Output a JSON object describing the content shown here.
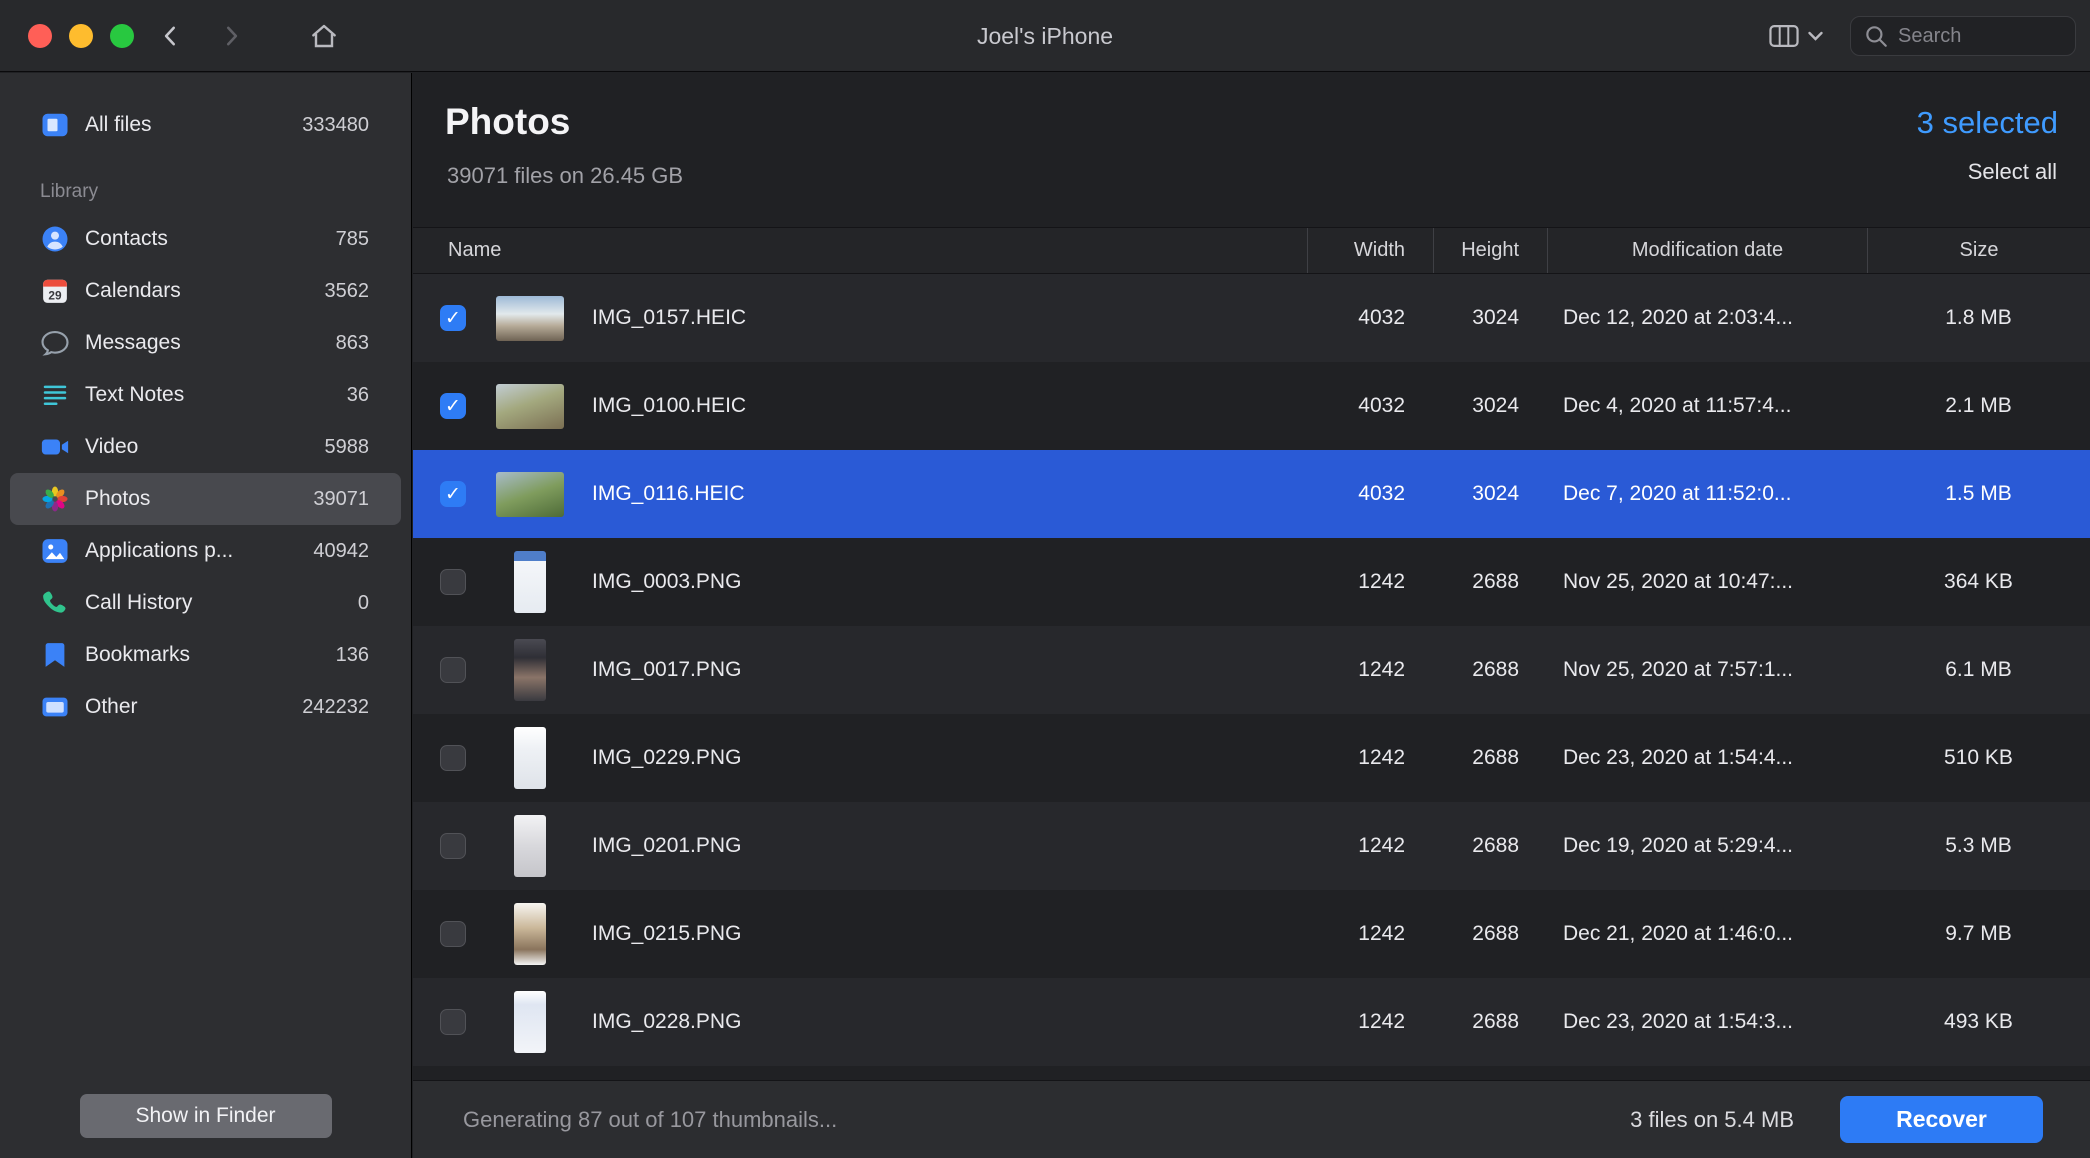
{
  "titlebar": {
    "title": "Joel's iPhone",
    "traffic_lights": [
      "close",
      "minimize",
      "zoom"
    ],
    "back_icon": "chevron-left-icon",
    "forward_icon": "chevron-right-icon",
    "home_icon": "home-icon",
    "view_selector_icon": "view-columns-icon",
    "view_selector_chevron": "chevron-down-icon",
    "search_icon": "search-icon",
    "search_placeholder": "Search"
  },
  "sidebar": {
    "all_files": {
      "label": "All files",
      "count": "333480",
      "icon": "all-files-icon"
    },
    "section_label": "Library",
    "items": [
      {
        "label": "Contacts",
        "count": "785",
        "icon": "contacts-icon",
        "selected": false
      },
      {
        "label": "Calendars",
        "count": "3562",
        "icon": "calendars-icon",
        "selected": false
      },
      {
        "label": "Messages",
        "count": "863",
        "icon": "messages-icon",
        "selected": false
      },
      {
        "label": "Text Notes",
        "count": "36",
        "icon": "text-notes-icon",
        "selected": false
      },
      {
        "label": "Video",
        "count": "5988",
        "icon": "video-icon",
        "selected": false
      },
      {
        "label": "Photos",
        "count": "39071",
        "icon": "photos-icon",
        "selected": true
      },
      {
        "label": "Applications p...",
        "count": "40942",
        "icon": "applications-icon",
        "selected": false
      },
      {
        "label": "Call History",
        "count": "0",
        "icon": "call-history-icon",
        "selected": false
      },
      {
        "label": "Bookmarks",
        "count": "136",
        "icon": "bookmarks-icon",
        "selected": false
      },
      {
        "label": "Other",
        "count": "242232",
        "icon": "other-icon",
        "selected": false
      }
    ],
    "show_in_finder_label": "Show in Finder"
  },
  "main": {
    "title": "Photos",
    "subtitle": "39071 files on 26.45 GB",
    "selection": {
      "count_label": "3 selected",
      "select_all_label": "Select all"
    },
    "table": {
      "columns": [
        "Name",
        "Width",
        "Height",
        "Modification date",
        "Size"
      ],
      "rows": [
        {
          "name": "IMG_0157.HEIC",
          "width": "4032",
          "height": "3024",
          "date": "Dec 12, 2020 at 2:03:4...",
          "size": "1.8 MB",
          "checked": true,
          "selected": false,
          "thumb": "mountain-snow",
          "orientation": "landscape"
        },
        {
          "name": "IMG_0100.HEIC",
          "width": "4032",
          "height": "3024",
          "date": "Dec 4, 2020 at 11:57:4...",
          "size": "2.1 MB",
          "checked": true,
          "selected": false,
          "thumb": "aerial-valley",
          "orientation": "landscape"
        },
        {
          "name": "IMG_0116.HEIC",
          "width": "4032",
          "height": "3024",
          "date": "Dec 7, 2020 at 11:52:0...",
          "size": "1.5 MB",
          "checked": true,
          "selected": true,
          "thumb": "aerial-green",
          "orientation": "landscape"
        },
        {
          "name": "IMG_0003.PNG",
          "width": "1242",
          "height": "2688",
          "date": "Nov 25, 2020 at 10:47:...",
          "size": "364 KB",
          "checked": false,
          "selected": false,
          "thumb": "screenshot-blue-header",
          "orientation": "portrait"
        },
        {
          "name": "IMG_0017.PNG",
          "width": "1242",
          "height": "2688",
          "date": "Nov 25, 2020 at 7:57:1...",
          "size": "6.1 MB",
          "checked": false,
          "selected": false,
          "thumb": "screenshot-dark",
          "orientation": "portrait"
        },
        {
          "name": "IMG_0229.PNG",
          "width": "1242",
          "height": "2688",
          "date": "Dec 23, 2020 at 1:54:4...",
          "size": "510 KB",
          "checked": false,
          "selected": false,
          "thumb": "screenshot-light",
          "orientation": "portrait"
        },
        {
          "name": "IMG_0201.PNG",
          "width": "1242",
          "height": "2688",
          "date": "Dec 19, 2020 at 5:29:4...",
          "size": "5.3 MB",
          "checked": false,
          "selected": false,
          "thumb": "screenshot-gray",
          "orientation": "portrait"
        },
        {
          "name": "IMG_0215.PNG",
          "width": "1242",
          "height": "2688",
          "date": "Dec 21, 2020 at 1:46:0...",
          "size": "9.7 MB",
          "checked": false,
          "selected": false,
          "thumb": "screenshot-photo",
          "orientation": "portrait"
        },
        {
          "name": "IMG_0228.PNG",
          "width": "1242",
          "height": "2688",
          "date": "Dec 23, 2020 at 1:54:3...",
          "size": "493 KB",
          "checked": false,
          "selected": false,
          "thumb": "screenshot-light-2",
          "orientation": "portrait"
        }
      ]
    }
  },
  "statusbar": {
    "progress_text": "Generating 87 out of 107 thumbnails...",
    "selection_summary": "3 files on 5.4 MB",
    "recover_label": "Recover"
  },
  "colors": {
    "accent_blue": "#2e7cf5",
    "selection_row_blue": "#2a5ad6",
    "selected_count_blue": "#3f9bff",
    "traffic_red": "#ff5f57",
    "traffic_yellow": "#febc2e",
    "traffic_green": "#28c840"
  }
}
